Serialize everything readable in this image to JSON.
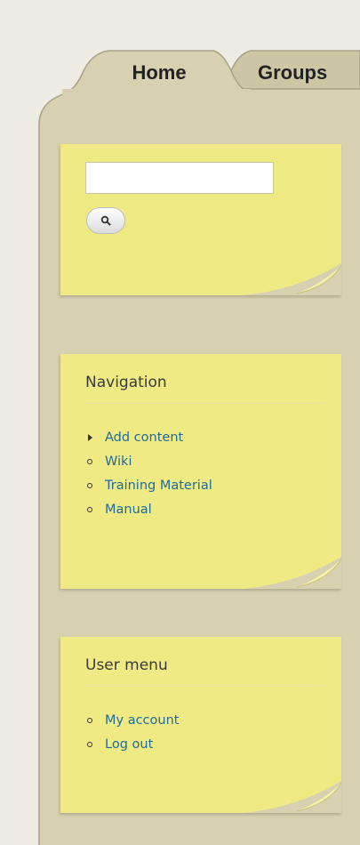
{
  "tabs": [
    {
      "label": "Home"
    },
    {
      "label": "Groups"
    }
  ],
  "search": {
    "placeholder": "",
    "value": "",
    "button_icon": "search-icon"
  },
  "navigation": {
    "title": "Navigation",
    "items": [
      {
        "label": "Add content",
        "bullet": "arrow"
      },
      {
        "label": "Wiki",
        "bullet": "circle"
      },
      {
        "label": "Training Material",
        "bullet": "circle"
      },
      {
        "label": "Manual",
        "bullet": "circle"
      }
    ]
  },
  "user_menu": {
    "title": "User menu",
    "items": [
      {
        "label": "My account",
        "bullet": "circle"
      },
      {
        "label": "Log out",
        "bullet": "circle"
      }
    ]
  },
  "colors": {
    "page_background": "#efece5",
    "frame_background": "#d7d0b1",
    "note_yellow": "#f0ea84",
    "link_blue": "#1f6b99"
  }
}
